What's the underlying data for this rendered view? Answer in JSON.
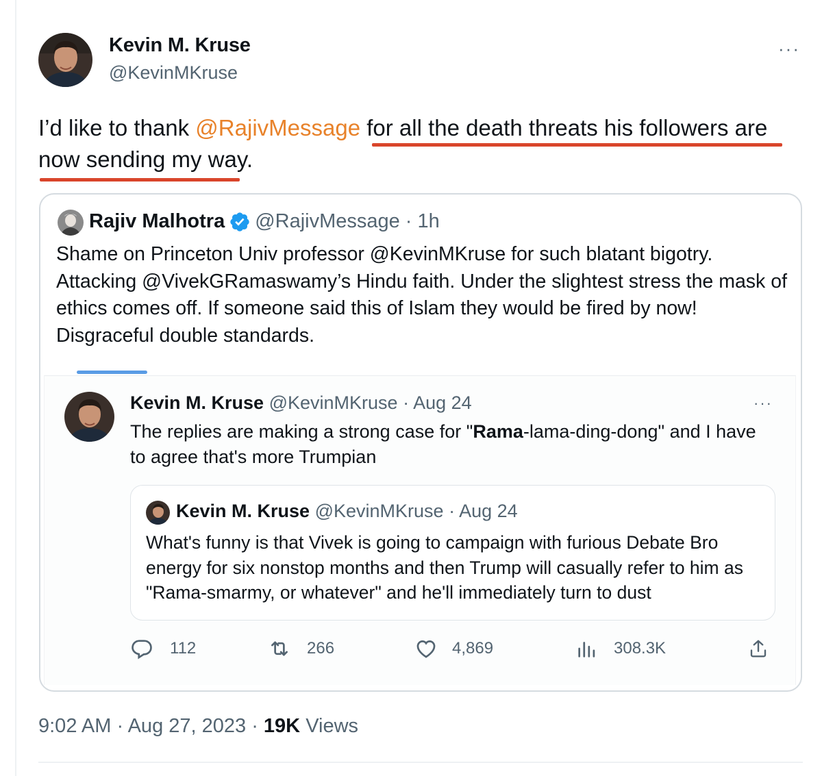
{
  "tweet": {
    "author_name": "Kevin M. Kruse",
    "author_handle": "@KevinMKruse",
    "more_icon": "···",
    "text_before": "I’d like to thank ",
    "text_mention": "@RajivMessage",
    "text_after": " for all the death threats his followers are now sending my way.",
    "underline_color": "#d9452b",
    "mention_color": "#e8822a",
    "time": "9:02 AM",
    "date": "Aug 27, 2023",
    "views_count": "19K",
    "views_label": "Views"
  },
  "quote": {
    "author_name": "Rajiv Malhotra",
    "verified_icon": "verified-badge-icon",
    "author_handle": "@RajivMessage",
    "time": "· 1h",
    "text": "Shame on Princeton Univ professor @KevinMKruse for such blatant bigotry. Attacking @VivekGRamaswamy’s Hindu faith. Under the slightest stress the mask of ethics comes off. If someone said this of Islam they would be fired by now! Disgraceful double standards."
  },
  "embedded": {
    "author_name": "Kevin M. Kruse",
    "author_handle": "@KevinMKruse",
    "time": "· Aug 24",
    "more_icon": "···",
    "text_before": "The replies are making a strong case for \"",
    "text_bold": "Rama",
    "text_after": "-lama-ding-dong\" and I have to agree that's more Trumpian",
    "nested": {
      "author_name": "Kevin M. Kruse",
      "author_handle": "@KevinMKruse",
      "time": "· Aug 24",
      "text": "What's funny is that Vivek is going to campaign with furious Debate Bro energy for six nonstop months and then Trump will casually refer to him as \"Rama-smarmy, or whatever\" and he'll immediately turn to dust"
    },
    "actions": {
      "replies": "112",
      "retweets": "266",
      "likes": "4,869",
      "views": "308.3K"
    }
  },
  "colors": {
    "text": "#0f1419",
    "muted": "#536471",
    "verified": "#1d9bf0",
    "tab_indicator": "#5a9ce5"
  }
}
